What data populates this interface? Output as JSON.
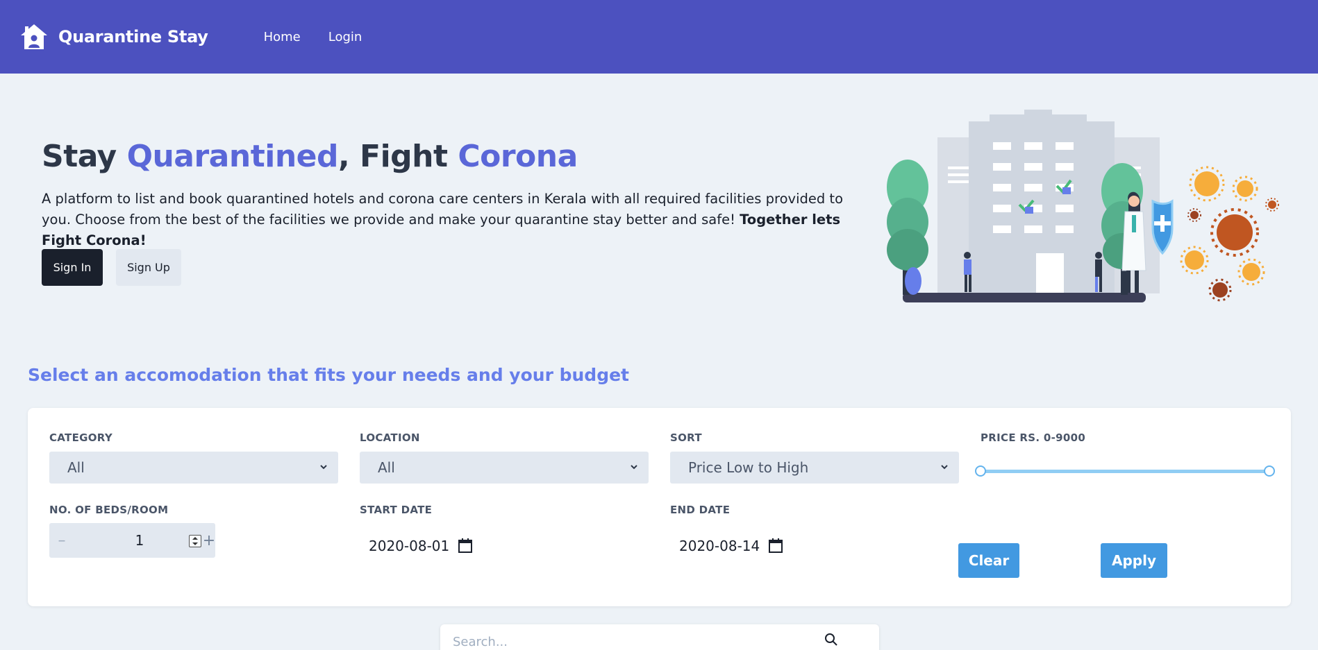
{
  "navbar": {
    "brand": "Quarantine Stay",
    "links": [
      "Home",
      "Login"
    ],
    "icon": "house-user-icon"
  },
  "hero": {
    "title_parts": [
      "Stay ",
      "Quarantined",
      ", Fight ",
      "Corona"
    ],
    "description": "A platform to list and book quarantined hotels and corona care centers in Kerala with all required facilities provided to you. Choose from the best of the facilities we provide and make your quarantine stay better and safe! ",
    "description_bold": "Together lets Fight Corona!",
    "signin_label": "Sign In",
    "signup_label": "Sign Up"
  },
  "filters": {
    "section_title": "Select an accomodation that fits your needs and your budget",
    "category": {
      "label": "CATEGORY",
      "value": "All"
    },
    "location": {
      "label": "LOCATION",
      "value": "All"
    },
    "sort": {
      "label": "SORT",
      "value": "Price Low to High"
    },
    "price": {
      "label": "PRICE RS. 0-9000",
      "min": 0,
      "max": 9000,
      "low_fraction": 0,
      "high_fraction": 1
    },
    "beds": {
      "label": "NO. OF BEDS/ROOM",
      "value": "1",
      "minus": "–",
      "plus": "+"
    },
    "start_date": {
      "label": "START DATE",
      "value": "2020-08-01"
    },
    "end_date": {
      "label": "END DATE",
      "value": "2020-08-14"
    },
    "clear_label": "Clear",
    "apply_label": "Apply"
  },
  "search": {
    "placeholder": "Search..."
  },
  "colors": {
    "navbar": "#4c51bf",
    "accent": "#5a67d8",
    "button_blue": "#4299e1",
    "background": "#edf2f7"
  }
}
